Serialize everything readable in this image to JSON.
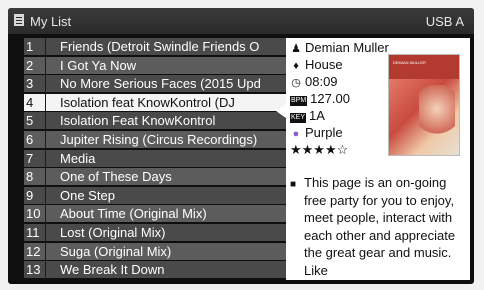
{
  "header": {
    "title": "My List",
    "source": "USB A"
  },
  "tracks": [
    {
      "num": "1",
      "title": "Friends (Detroit Swindle Friends O"
    },
    {
      "num": "2",
      "title": "I Got Ya Now"
    },
    {
      "num": "3",
      "title": "No More Serious Faces (2015 Upd"
    },
    {
      "num": "4",
      "title": "Isolation feat KnowKontrol (DJ"
    },
    {
      "num": "5",
      "title": "Isolation Feat KnowKontrol"
    },
    {
      "num": "6",
      "title": "Jupiter Rising (Circus Recordings)"
    },
    {
      "num": "7",
      "title": "Media"
    },
    {
      "num": "8",
      "title": "One of These Days"
    },
    {
      "num": "9",
      "title": "One Step"
    },
    {
      "num": "10",
      "title": "About Time (Original Mix)"
    },
    {
      "num": "11",
      "title": "Lost (Original Mix)"
    },
    {
      "num": "12",
      "title": "Suga (Original Mix)"
    },
    {
      "num": "13",
      "title": "We Break It Down"
    }
  ],
  "selected_index": 3,
  "info": {
    "artist": "Demian Muller",
    "genre": "House",
    "time": "08:09",
    "bpm_tag": "BPM",
    "bpm": "127.00",
    "key_tag": "KEY",
    "key": "1A",
    "color": "Purple",
    "color_hex": "#8a5cc8",
    "rating": "★★★★☆",
    "rating_value": 4,
    "comment": "This page is an on-going free party for you to enjoy, meet people, interact with each other and appreciate the great gear and music. Like"
  },
  "artwork": {
    "name": "DEMIAN MULLER"
  },
  "icons": {
    "list": "list-icon",
    "artist": "person-icon",
    "genre": "genre-icon",
    "time": "clock-icon",
    "color": "color-dot-icon",
    "comment": "comment-icon"
  }
}
